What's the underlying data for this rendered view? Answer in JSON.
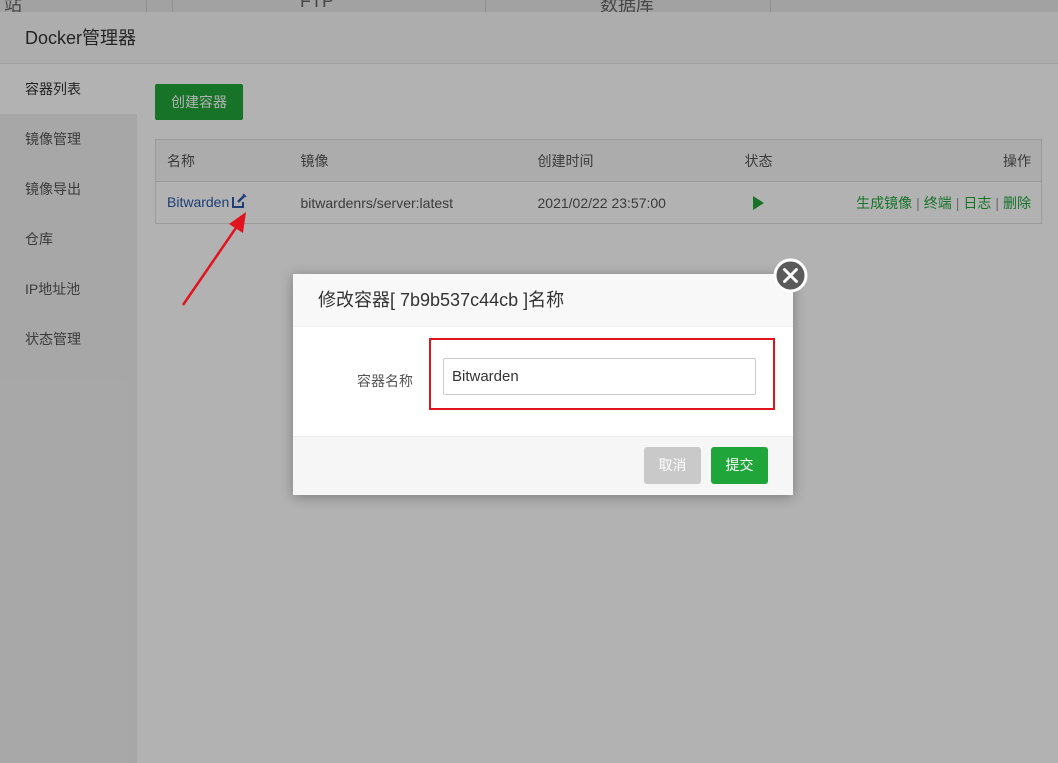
{
  "bg_tabs": [
    "站",
    "FTP",
    "数据库"
  ],
  "window": {
    "title": "Docker管理器"
  },
  "sidebar": {
    "items": [
      {
        "label": "容器列表"
      },
      {
        "label": "镜像管理"
      },
      {
        "label": "镜像导出"
      },
      {
        "label": "仓库"
      },
      {
        "label": "IP地址池"
      },
      {
        "label": "状态管理"
      }
    ]
  },
  "toolbar": {
    "create_label": "创建容器"
  },
  "table": {
    "headers": [
      "名称",
      "镜像",
      "创建时间",
      "状态",
      "操作"
    ],
    "rows": [
      {
        "name": "Bitwarden",
        "image": "bitwardenrs/server:latest",
        "created": "2021/02/22 23:57:00",
        "status_icon": "play-icon",
        "actions": [
          "生成镜像",
          "终端",
          "日志",
          "删除"
        ]
      }
    ],
    "separator": "|"
  },
  "modal": {
    "title": "修改容器[ 7b9b537c44cb ]名称",
    "field_label": "容器名称",
    "field_value": "Bitwarden",
    "cancel_label": "取消",
    "submit_label": "提交",
    "close_icon": "close-icon"
  },
  "colors": {
    "accent": "#20a53a",
    "annotation": "#e0141e",
    "link": "#2b5aa8"
  }
}
